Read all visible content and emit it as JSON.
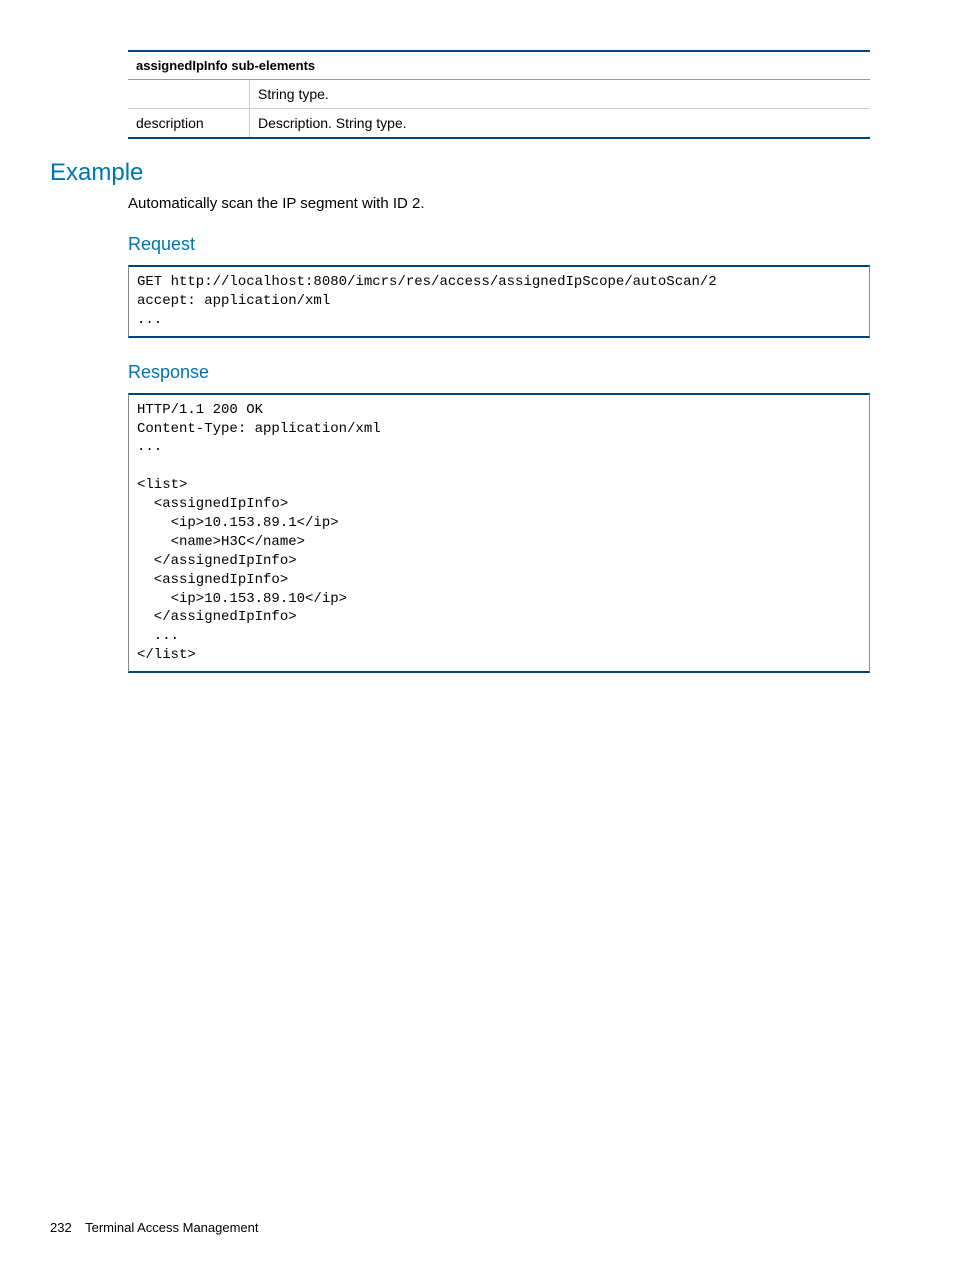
{
  "table": {
    "header": "assignedIpInfo sub-elements",
    "rows": [
      {
        "c1": "",
        "c2": "String type."
      },
      {
        "c1": "description",
        "c2": "Description.\nString type."
      }
    ]
  },
  "example_heading": "Example",
  "example_desc": "Automatically scan the IP segment with ID 2.",
  "request_heading": "Request",
  "request_code": "GET http://localhost:8080/imcrs/res/access/assignedIpScope/autoScan/2\naccept: application/xml\n...",
  "response_heading": "Response",
  "response_code": "HTTP/1.1 200 OK\nContent-Type: application/xml\n...\n\n<list>\n  <assignedIpInfo>\n    <ip>10.153.89.1</ip>\n    <name>H3C</name>\n  </assignedIpInfo>\n  <assignedIpInfo>\n    <ip>10.153.89.10</ip>\n  </assignedIpInfo>\n  ...\n</list>",
  "footer": {
    "page": "232",
    "title": "Terminal Access Management"
  }
}
